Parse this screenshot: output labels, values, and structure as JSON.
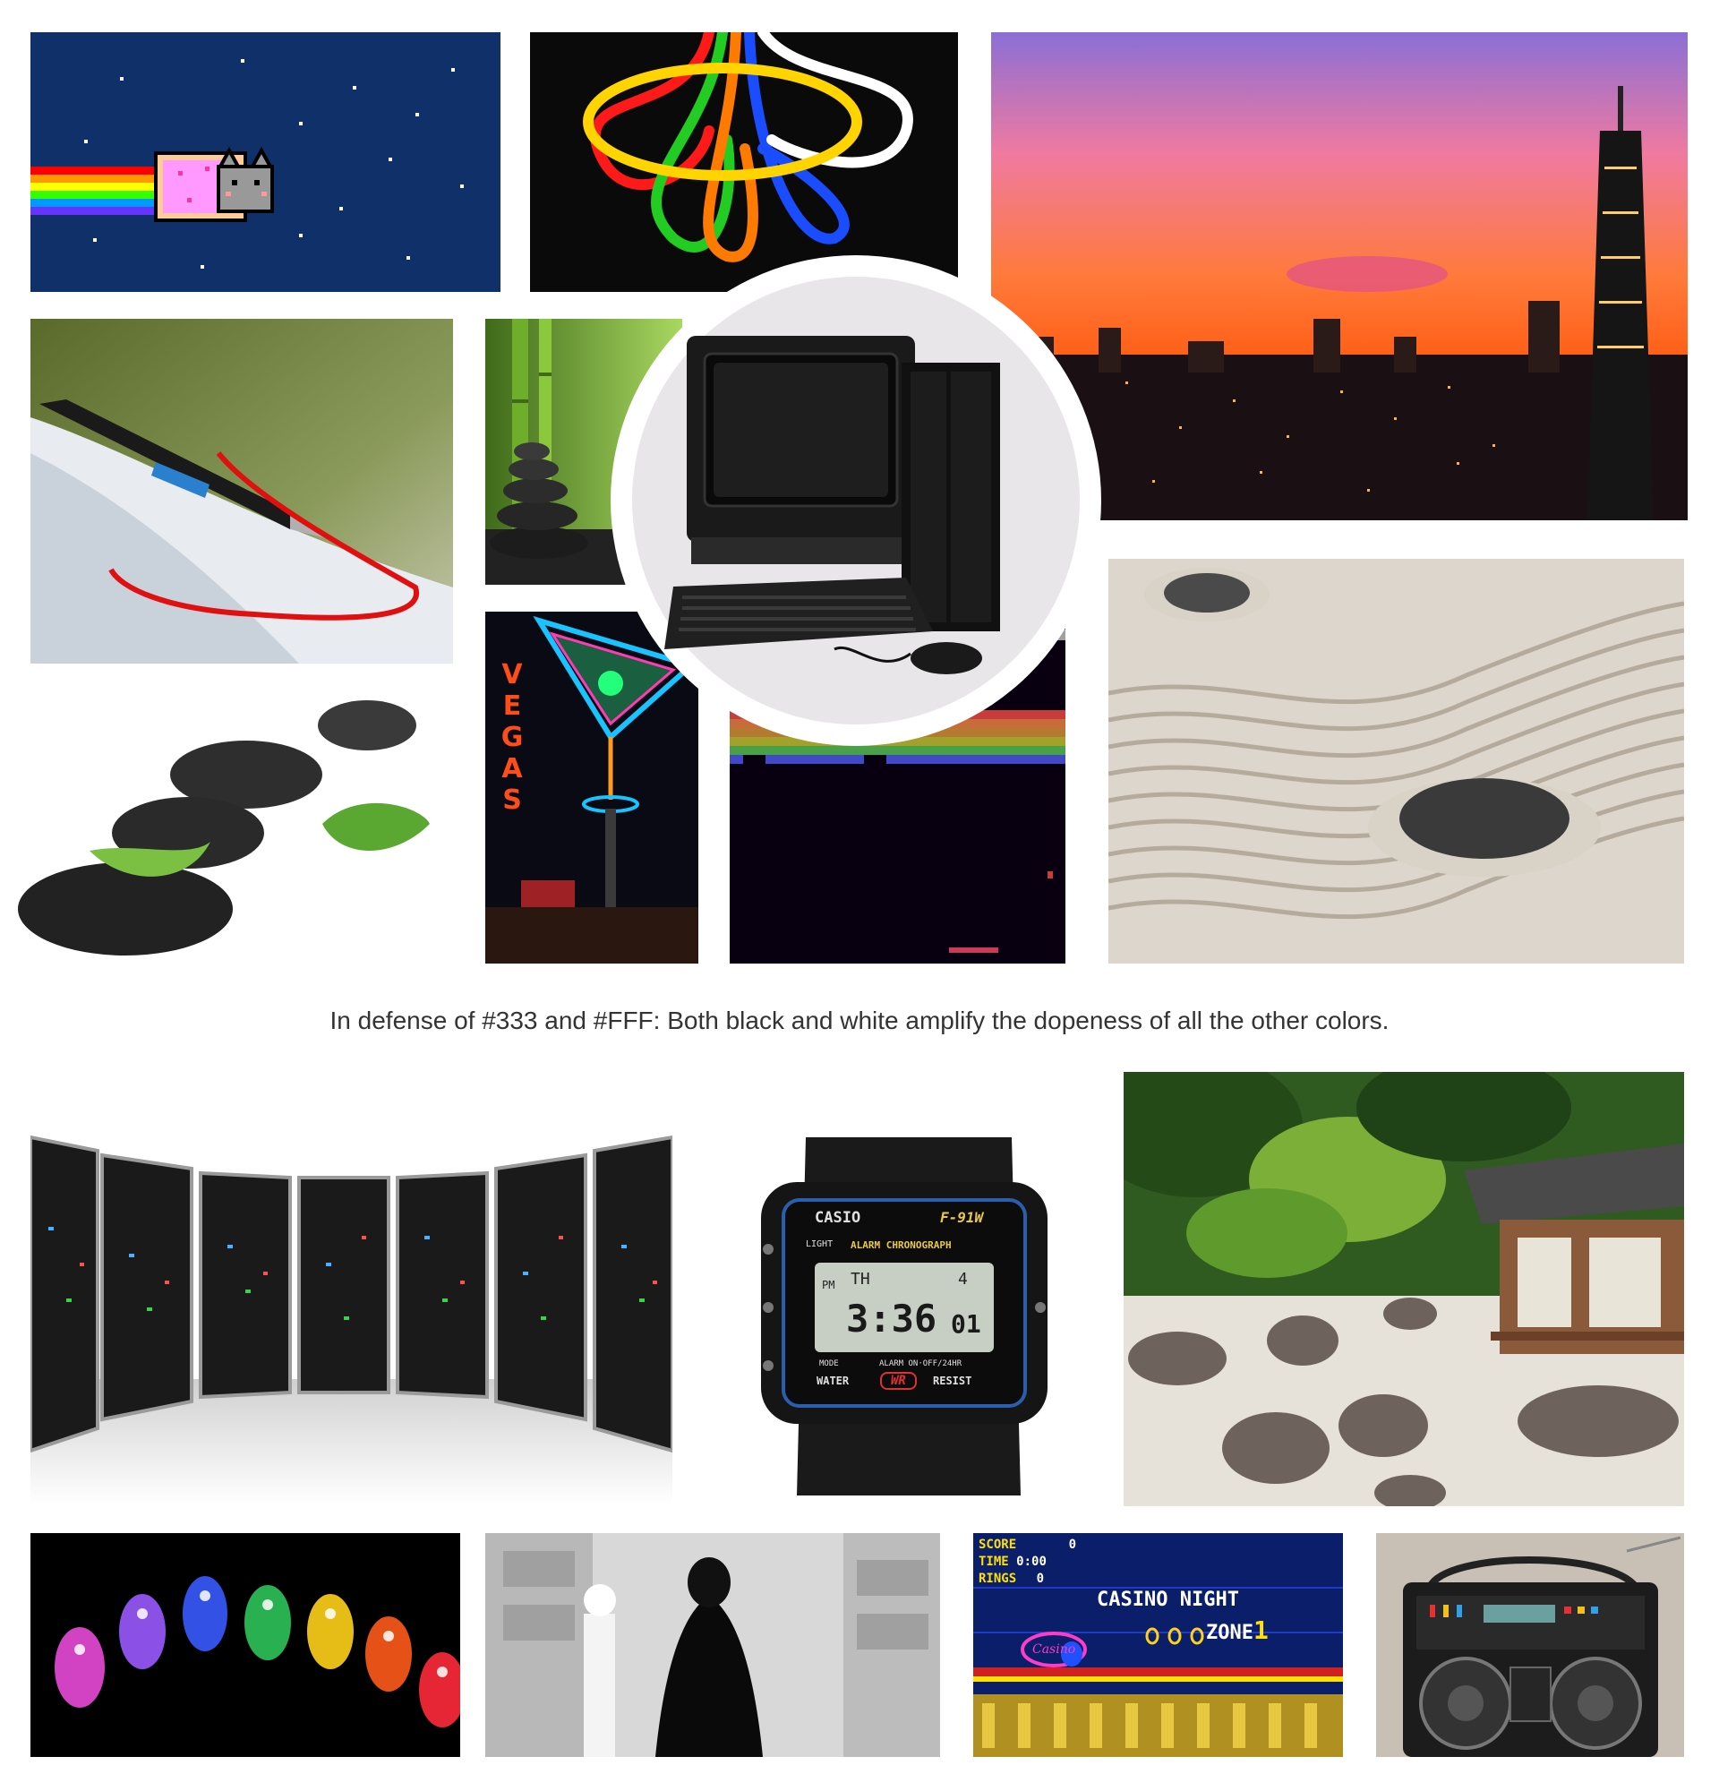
{
  "caption": "In defense of #333 and #FFF: Both black and white amplify the dopeness of all the other colors.",
  "colors": {
    "background": "#FFFFFF",
    "text": "#333333"
  },
  "watch": {
    "brand": "CASIO",
    "model": "F-91W",
    "band_top": "ALARM CHRONOGRAPH",
    "light_label": "LIGHT",
    "pm": "PM",
    "day": "TH",
    "date": "4",
    "time": "3:36",
    "seconds": "01",
    "mode_label": "MODE",
    "alarm_label": "ALARM ON·OFF/24HR",
    "water": "WATER",
    "wr": "WR",
    "resist": "RESIST"
  },
  "game_hud": {
    "score_label": "SCORE",
    "score_value": "0",
    "time_label": "TIME",
    "time_value": "0:00",
    "rings_label": "RINGS",
    "rings_value": "0",
    "zone_line1": "CASINO NIGHT",
    "zone_line2": "ZONE",
    "act": "1",
    "sign": "Casino"
  },
  "neon_sign": {
    "letters": [
      "V",
      "E",
      "G",
      "A",
      "S"
    ]
  }
}
